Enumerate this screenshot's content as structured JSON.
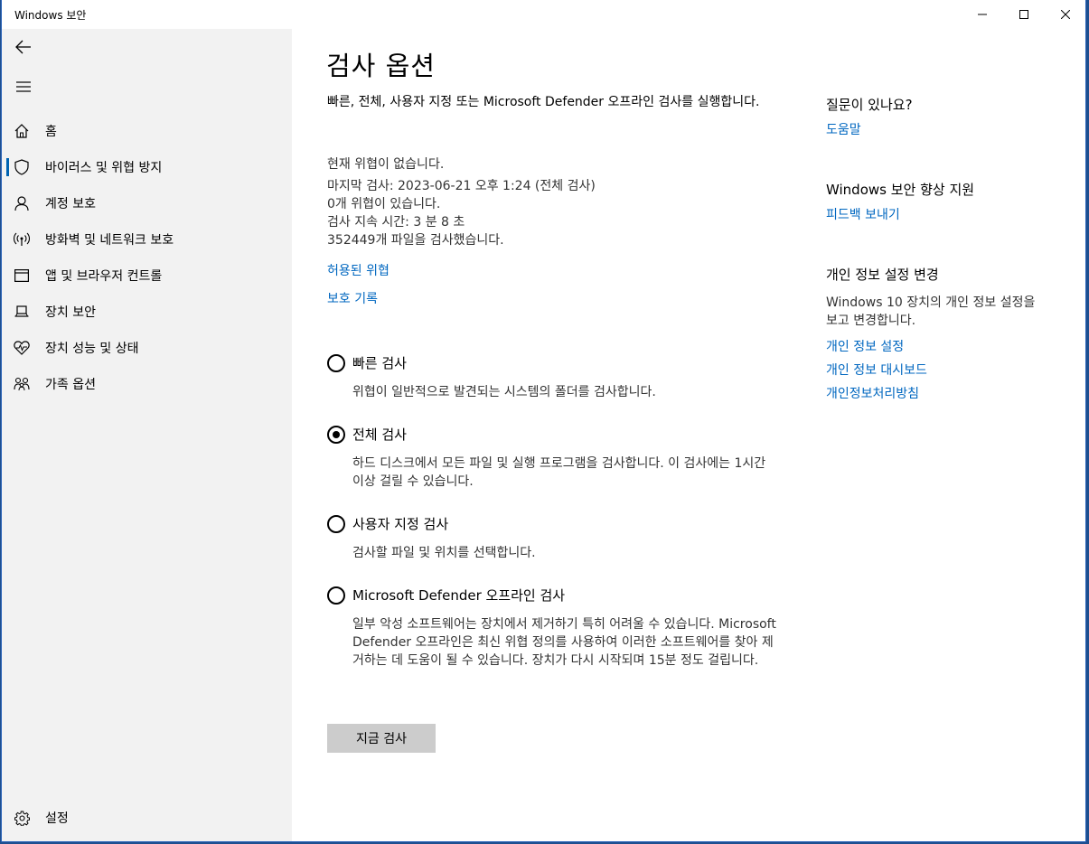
{
  "window": {
    "title": "Windows 보안"
  },
  "sidebar": {
    "items": [
      {
        "label": "홈",
        "icon": "home-icon"
      },
      {
        "label": "바이러스 및 위협 방지",
        "icon": "shield-icon"
      },
      {
        "label": "계정 보호",
        "icon": "person-icon"
      },
      {
        "label": "방화벽 및 네트워크 보호",
        "icon": "wifi-icon"
      },
      {
        "label": "앱 및 브라우저 컨트롤",
        "icon": "app-window-icon"
      },
      {
        "label": "장치 보안",
        "icon": "laptop-icon"
      },
      {
        "label": "장치 성능 및 상태",
        "icon": "heart-pulse-icon"
      },
      {
        "label": "가족 옵션",
        "icon": "family-icon"
      }
    ],
    "settings_label": "설정"
  },
  "main": {
    "title": "검사 옵션",
    "description": "빠른, 전체, 사용자 지정 또는 Microsoft Defender 오프라인 검사를 실행합니다.",
    "status_lines": [
      "현재 위협이 없습니다.",
      "마지막 검사: 2023-06-21 오후 1:24 (전체 검사)",
      "0개 위협이 있습니다.",
      "검사 지속 시간: 3 분 8 초",
      "352449개 파일을 검사했습니다."
    ],
    "links": {
      "allowed_threats": "허용된 위협",
      "protection_history": "보호 기록"
    },
    "options": [
      {
        "label": "빠른 검사",
        "desc": "위협이 일반적으로 발견되는 시스템의 폴더를 검사합니다.",
        "checked": false
      },
      {
        "label": "전체 검사",
        "desc": "하드 디스크에서 모든 파일 및 실행 프로그램을 검사합니다. 이 검사에는 1시간 이상 걸릴 수 있습니다.",
        "checked": true
      },
      {
        "label": "사용자 지정 검사",
        "desc": "검사할 파일 및 위치를 선택합니다.",
        "checked": false
      },
      {
        "label": "Microsoft Defender 오프라인 검사",
        "desc": "일부 악성 소프트웨어는 장치에서 제거하기 특히 어려울 수 있습니다. Microsoft Defender 오프라인은 최신 위협 정의를 사용하여 이러한 소프트웨어를 찾아 제거하는 데 도움이 될 수 있습니다. 장치가 다시 시작되며 15분 정도 걸립니다.",
        "checked": false
      }
    ],
    "scan_button": "지금 검사"
  },
  "right": {
    "help_heading": "질문이 있나요?",
    "help_link": "도움말",
    "improve_heading": "Windows 보안 향상 지원",
    "feedback_link": "피드백 보내기",
    "privacy_heading": "개인 정보 설정 변경",
    "privacy_desc": "Windows 10 장치의 개인 정보 설정을 보고 변경합니다.",
    "privacy_links": [
      "개인 정보 설정",
      "개인 정보 대시보드",
      "개인정보처리방침"
    ]
  },
  "colors": {
    "accent": "#0067c0",
    "sidebar_bg": "#f2f2f2",
    "button_bg": "#cccccc"
  }
}
